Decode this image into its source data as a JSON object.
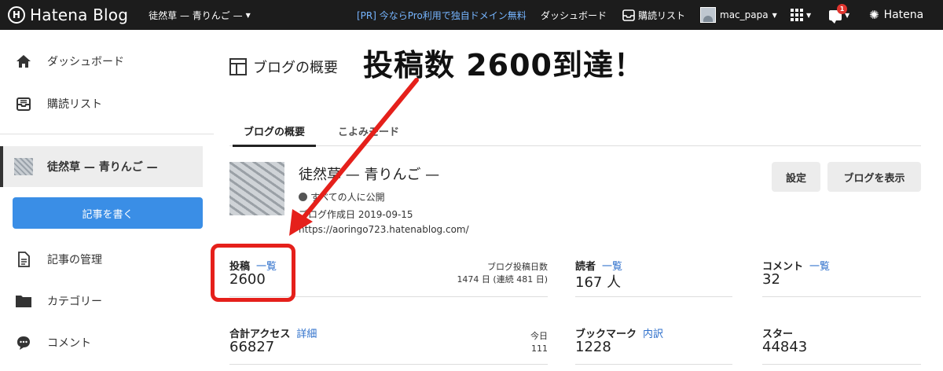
{
  "topbar": {
    "brand": "Hatena Blog",
    "blog_selector": "徒然草 — 青りんご —",
    "pr_link": "[PR] 今ならPro利用で独自ドメイン無料",
    "dashboard": "ダッシュボード",
    "subscriptions": "購読リスト",
    "username": "mac_papa",
    "notification_count": "1",
    "hatena": "Hatena"
  },
  "sidebar": {
    "dashboard": "ダッシュボード",
    "subscriptions": "購読リスト",
    "blog_name": "徒然草 — 青りんご —",
    "write_button": "記事を書く",
    "manage_posts": "記事の管理",
    "categories": "カテゴリー",
    "comments": "コメント"
  },
  "main": {
    "page_title": "ブログの概要",
    "headline": "投稿数 2600到達！",
    "tabs": [
      "ブログの概要",
      "こよみモード"
    ],
    "blog": {
      "name": "徒然草 — 青りんご —",
      "visibility": "すべての人に公開",
      "created": "ブログ作成日 2019-09-15",
      "url": "https://aoringo723.hatenablog.com/"
    },
    "buttons": {
      "settings": "設定",
      "view_blog": "ブログを表示"
    },
    "stats": {
      "posts": {
        "label": "投稿",
        "link": "一覧",
        "value": "2600",
        "days_label": "ブログ投稿日数",
        "days_value": "1474 日 (連続 481 日)"
      },
      "readers": {
        "label": "読者",
        "link": "一覧",
        "value": "167 人"
      },
      "comments": {
        "label": "コメント",
        "link": "一覧",
        "value": "32"
      },
      "access": {
        "label": "合計アクセス",
        "link": "詳細",
        "value": "66827",
        "today_label": "今日",
        "today_value": "111"
      },
      "bookmarks": {
        "label": "ブックマーク",
        "link": "内訳",
        "value": "1228"
      },
      "stars": {
        "label": "スター",
        "value": "44843"
      }
    }
  },
  "colors": {
    "topbar": "#1c1c1c",
    "accent_blue": "#3a8ee6",
    "link": "#2d6fcb",
    "annotation_red": "#e5201b"
  }
}
